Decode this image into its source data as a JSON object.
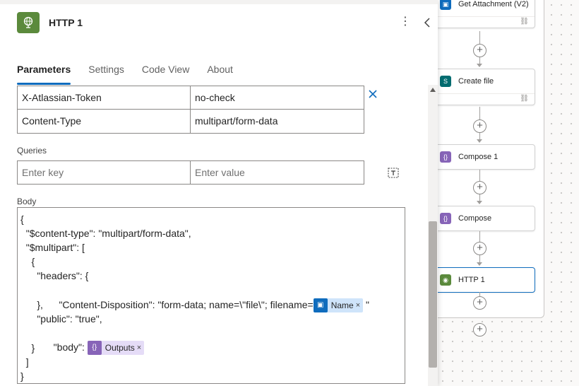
{
  "canvas": {
    "nodes": [
      {
        "label": "Get Attachment (V2)",
        "icon": "outlook-icon",
        "color": "#0f6cbd"
      },
      {
        "label": "Create file",
        "icon": "sharepoint-icon",
        "color": "#036c70"
      },
      {
        "label": "Compose 1",
        "icon": "compose-icon",
        "color": "#8764b8"
      },
      {
        "label": "Compose",
        "icon": "compose-icon",
        "color": "#8764b8"
      },
      {
        "label": "HTTP 1",
        "icon": "http-icon",
        "color": "#5b8a3c"
      }
    ]
  },
  "header": {
    "title": "HTTP 1",
    "icon": "http-globe-icon",
    "accent": "#5b8a3c"
  },
  "tabs": [
    "Parameters",
    "Settings",
    "Code View",
    "About"
  ],
  "active_tab": "Parameters",
  "headers_table": {
    "rows": [
      {
        "key": "X-Atlassian-Token",
        "value": "no-check"
      },
      {
        "key": "Content-Type",
        "value": "multipart/form-data"
      }
    ]
  },
  "queries": {
    "label": "Queries",
    "key_placeholder": "Enter key",
    "value_placeholder": "Enter value"
  },
  "body": {
    "label": "Body",
    "lines": [
      "{",
      "  \"$content-type\": \"multipart/form-data\",",
      "  \"$multipart\": [",
      "    {",
      "      \"headers\": {",
      "        \"Content-Disposition\": \"form-data; name=\\\"file\\\"; filename=",
      "      },",
      "      \"public\": \"true\",",
      "      \"body\": ",
      "    }",
      "  ]",
      "}"
    ],
    "filename_token": "Name",
    "filename_suffix": " \"",
    "body_token": "Outputs",
    "token_close": "×"
  },
  "colors": {
    "accent": "#0f6cbd",
    "http_green": "#5b8a3c",
    "compose_purple": "#8764b8"
  }
}
